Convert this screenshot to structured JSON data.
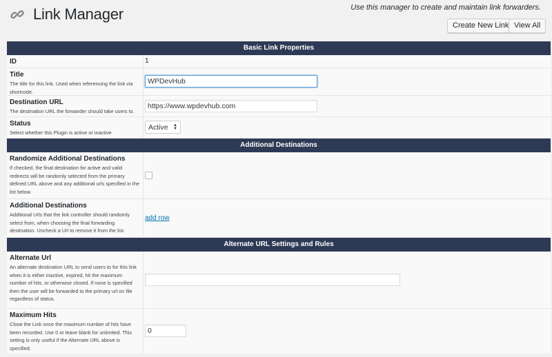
{
  "header": {
    "title": "Link Manager",
    "subtitle": "Use this manager to create and maintain link forwarders.",
    "buttons": {
      "create": "Create New Link",
      "view_all": "View All"
    },
    "icon": "chain-link-icon"
  },
  "sections": {
    "basic": "Basic Link Properties",
    "additional": "Additional Destinations",
    "alternate": "Alternate URL Settings and Rules"
  },
  "fields": {
    "id": {
      "label": "ID",
      "value": "1"
    },
    "title": {
      "label": "Title",
      "desc": "The title for this link. Used when referencing the link via shortcode.",
      "value": "WPDevHub"
    },
    "destination": {
      "label": "Destination URL",
      "desc": "The destination URL the forwarder should take users to.",
      "value": "https://www.wpdevhub.com"
    },
    "status": {
      "label": "Status",
      "desc": "Select whether this Plugin is active or inactive",
      "value": "Active"
    },
    "randomize": {
      "label": "Randomize Additional Destinations",
      "desc": "If checked, the final destination for active and valid redirects will be randomly selected from the primary defined URL above and any additional urls specified in the list below.",
      "checked": false
    },
    "additional_destinations": {
      "label": "Additional Destinations",
      "desc": "Additional Urls that the link controller should randomly select from, when choosing the final forwarding destination. Uncheck a Url to remove it from the list.",
      "link": "add row"
    },
    "alternate_url": {
      "label": "Alternate Url",
      "desc": "An alternate destination URL to send users to for this link when it is either inactive, expired, hit the maximum number of hits, or otherwise closed. If none is specified then the user will be forwarded to the primary url on file regardless of status.",
      "value": ""
    },
    "max_hits": {
      "label": "Maximum Hits",
      "desc": "Close the Link once the maximum number of hits have been recorded. Use 0 or leave blank for unlimited. This setting is only useful if the Alternate URL above is specified.",
      "value": "0"
    }
  },
  "colors": {
    "section_bg": "#2e3a55",
    "link": "#0073aa",
    "page_bg": "#f1f1f1"
  }
}
